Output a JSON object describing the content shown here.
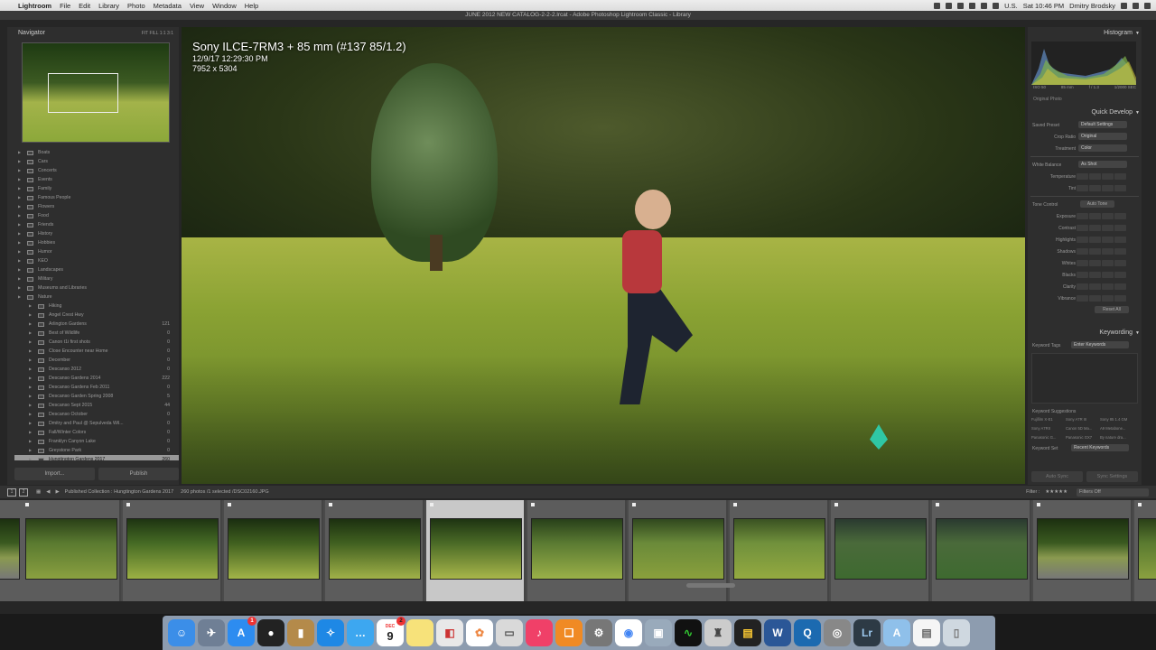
{
  "menubar": {
    "app": "Lightroom",
    "items": [
      "File",
      "Edit",
      "Library",
      "Photo",
      "Metadata",
      "View",
      "Window",
      "Help"
    ],
    "flag": "U.S.",
    "clock": "Sat 10:46 PM",
    "user": "Dmitry Brodsky"
  },
  "window_title": "JUNE 2012 NEW CATALOG-2-2-2.lrcat - Adobe Photoshop Lightroom Classic - Library",
  "navigator": {
    "title": "Navigator",
    "options": "FIT FILL 1:1 3:1"
  },
  "collections": [
    {
      "label": "Boats",
      "count": "",
      "level": 1
    },
    {
      "label": "Cars",
      "count": "",
      "level": 1
    },
    {
      "label": "Concerts",
      "count": "",
      "level": 1
    },
    {
      "label": "Events",
      "count": "",
      "level": 1
    },
    {
      "label": "Family",
      "count": "",
      "level": 1
    },
    {
      "label": "Famous People",
      "count": "",
      "level": 1
    },
    {
      "label": "Flowers",
      "count": "",
      "level": 1
    },
    {
      "label": "Food",
      "count": "",
      "level": 1
    },
    {
      "label": "Friends",
      "count": "",
      "level": 1
    },
    {
      "label": "History",
      "count": "",
      "level": 1
    },
    {
      "label": "Hobbies",
      "count": "",
      "level": 1
    },
    {
      "label": "Humor",
      "count": "",
      "level": 1
    },
    {
      "label": "KEO",
      "count": "",
      "level": 1
    },
    {
      "label": "Landscapes",
      "count": "",
      "level": 1
    },
    {
      "label": "Military",
      "count": "",
      "level": 1
    },
    {
      "label": "Museums and Libraries",
      "count": "",
      "level": 1
    },
    {
      "label": "Nature",
      "count": "",
      "level": 1
    },
    {
      "label": "Hiking",
      "count": "",
      "level": 2
    },
    {
      "label": "Angel Crest Hwy",
      "count": "",
      "level": 2
    },
    {
      "label": "Arlington Gardens",
      "count": "121",
      "level": 2
    },
    {
      "label": "Best of Wildlife",
      "count": "0",
      "level": 2
    },
    {
      "label": "Canon t1i first shots",
      "count": "0",
      "level": 2
    },
    {
      "label": "Close Encounter near Home",
      "count": "0",
      "level": 2
    },
    {
      "label": "December",
      "count": "0",
      "level": 2
    },
    {
      "label": "Descanso 2012",
      "count": "0",
      "level": 2
    },
    {
      "label": "Descanso Gardens 2014",
      "count": "222",
      "level": 2
    },
    {
      "label": "Descanso Gardens Feb 2011",
      "count": "0",
      "level": 2
    },
    {
      "label": "Descanso Garden Spring 2008",
      "count": "5",
      "level": 2
    },
    {
      "label": "Descanso Sept 2015",
      "count": "44",
      "level": 2
    },
    {
      "label": "Descanso October",
      "count": "0",
      "level": 2
    },
    {
      "label": "Dmitry and Paul @ Sepulveda Wil...",
      "count": "0",
      "level": 2
    },
    {
      "label": "Fall/Winter Colors",
      "count": "0",
      "level": 2
    },
    {
      "label": "Franklyn Canyon Lake",
      "count": "0",
      "level": 2
    },
    {
      "label": "Greystone Park",
      "count": "0",
      "level": 2
    },
    {
      "label": "Hungtington Gardens 2017",
      "count": "260",
      "level": 2,
      "selected": true
    }
  ],
  "left_buttons": {
    "import": "Import...",
    "publish": "Publish"
  },
  "photo_info": {
    "camera": "Sony ILCE-7RM3 + 85 mm (#137 85/1.2)",
    "date": "12/9/17 12:29:30 PM",
    "size": "7952 x 5304"
  },
  "histogram": {
    "title": "Histogram",
    "iso": "ISO 50",
    "focal": "85 mm",
    "aperture": "f / 1.3",
    "shutter": "1/2000 SEC",
    "original_photo": "Original Photo"
  },
  "quick_develop": {
    "title": "Quick Develop",
    "saved_preset_label": "Saved Preset",
    "saved_preset_value": "Default Settings",
    "crop_label": "Crop Ratio",
    "crop_value": "Original",
    "treatment_label": "Treatment",
    "treatment_value": "Color",
    "wb_label": "White Balance",
    "wb_value": "As Shot",
    "temperature": "Temperature",
    "tint": "Tint",
    "tone_label": "Tone Control",
    "auto_tone": "Auto Tone",
    "exposure": "Exposure",
    "contrast": "Contrast",
    "highlights": "Highlights",
    "shadows": "Shadows",
    "whites": "Whites",
    "blacks": "Blacks",
    "clarity": "Clarity",
    "vibrance": "Vibrance",
    "reset": "Reset All"
  },
  "keywording": {
    "title": "Keywording",
    "tags_label": "Keyword Tags",
    "tags_value": "Enter Keywords",
    "suggestions_label": "Keyword Suggestions",
    "suggestions": [
      "Fujifilm X-E1",
      "Sony A7R III",
      "Sony 85 1.4 GM",
      "Sony A7RII",
      "Canon 5D Ma...",
      "A9 Metabone...",
      "Panasonic G...",
      "Panasonic GX7",
      "By nature dra..."
    ],
    "set_label": "Keyword Set",
    "set_value": "Recent Keywords"
  },
  "sync": {
    "autosync": "Auto Sync",
    "settings": "Sync Settings"
  },
  "filmstrip_bar": {
    "page1": "1",
    "page2": "2",
    "collection": "Published Collection : Hungtington Gardens 2017",
    "count": "260 photos /1 selected /",
    "filename": "DSC02160.JPG",
    "filter_label": "Filter :",
    "filters_off": "Filters Off"
  },
  "dock": {
    "calendar_month": "DEC",
    "calendar_day": "9",
    "appstore_badge": "1",
    "calendar_badge": "2"
  }
}
